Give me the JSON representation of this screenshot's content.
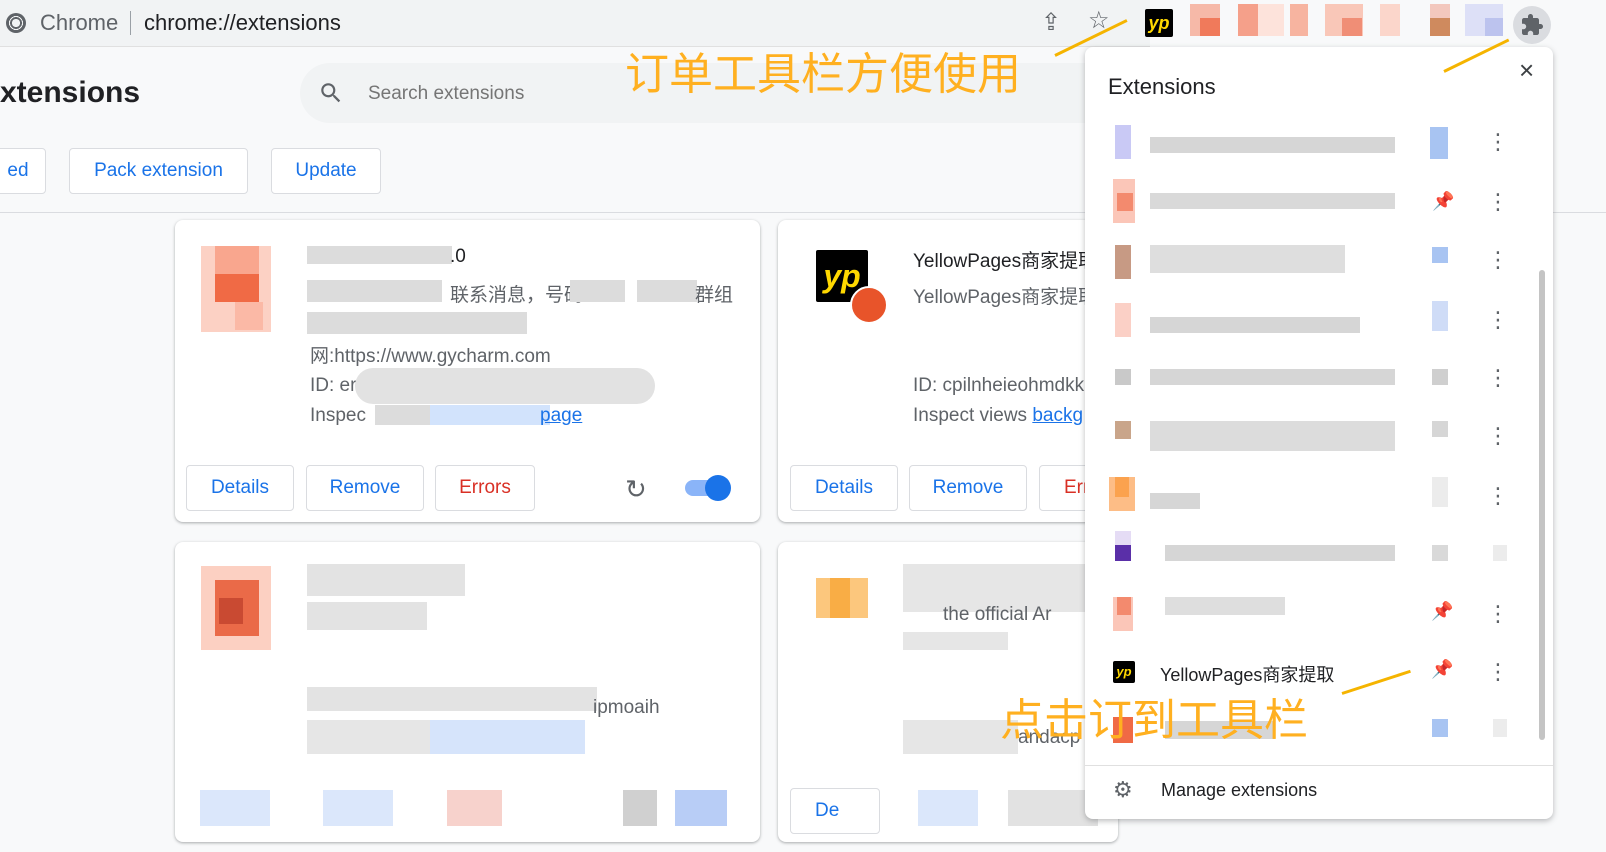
{
  "browser": {
    "label": "Chrome",
    "url": "chrome://extensions"
  },
  "page": {
    "title": "xtensions",
    "search_placeholder": "Search extensions",
    "buttons": {
      "load_unpacked": "ed",
      "pack": "Pack extension",
      "update": "Update"
    }
  },
  "cards": [
    {
      "name_suffix": ".0",
      "desc_fragment_1": "联系消息，号码",
      "desc_fragment_2": "群组",
      "website": "网:https://www.gycharm.com",
      "id_label": "ID: er",
      "inspect_label": "Inspec",
      "inspect_link": "page",
      "buttons": {
        "details": "Details",
        "remove": "Remove",
        "errors": "Errors"
      },
      "enabled": true
    },
    {
      "name": "YellowPages商家提取",
      "desc": "YellowPages商家提取",
      "id_label": "ID: cpilnheieohmdkk",
      "inspect_label": "Inspect views",
      "inspect_link": "backg",
      "buttons": {
        "details": "Details",
        "remove": "Remove",
        "errors": "Err"
      }
    },
    {
      "fragment": "ipmoaih"
    },
    {
      "fragment_1": "the official Ar",
      "fragment_2": "andacp",
      "buttons": {
        "details": "De"
      }
    }
  ],
  "popup": {
    "title": "Extensions",
    "close_icon": "close-icon",
    "items": [
      {
        "label": "",
        "pinned": false
      },
      {
        "label": "",
        "pinned": true
      },
      {
        "label": "",
        "pinned": false
      },
      {
        "label": "",
        "pinned": false
      },
      {
        "label": "",
        "pinned": false
      },
      {
        "label": "",
        "pinned": false
      },
      {
        "label": "",
        "pinned": false
      },
      {
        "label": "",
        "pinned": false
      },
      {
        "label": "",
        "pinned": true
      },
      {
        "label": "YellowPages商家提取",
        "pinned": true
      },
      {
        "label": "",
        "pinned": false
      }
    ],
    "manage": "Manage extensions"
  },
  "annotations": {
    "top": "订单工具栏方便使用",
    "bottom": "点击订到工具栏"
  },
  "colors": {
    "accent": "#1a73e8",
    "error": "#d93025",
    "annotation": "#ffb020"
  }
}
